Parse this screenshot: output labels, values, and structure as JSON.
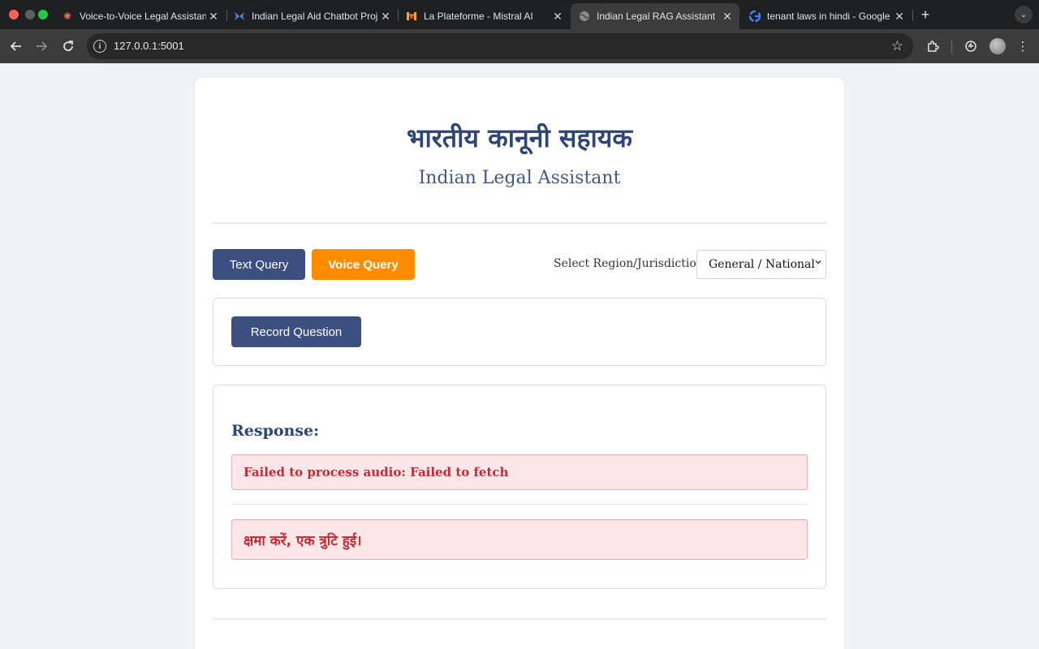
{
  "browser": {
    "tabs": [
      {
        "title": "Voice-to-Voice Legal Assistant",
        "icon": "asterisk-orange-icon"
      },
      {
        "title": "Indian Legal Aid Chatbot Project",
        "icon": "butterfly-blue-icon"
      },
      {
        "title": "La Plateforme - Mistral AI",
        "icon": "mistral-m-icon"
      },
      {
        "title": "Indian Legal RAG Assistant",
        "icon": "globe-icon",
        "active": true
      },
      {
        "title": "tenant laws in hindi - Google",
        "icon": "google-g-icon"
      }
    ],
    "url": "127.0.0.1:5001"
  },
  "header": {
    "title_hi": "भारतीय कानूनी सहायक",
    "title_en": "Indian Legal Assistant"
  },
  "mode": {
    "text_query": "Text Query",
    "voice_query": "Voice Query",
    "active": "voice_query"
  },
  "region": {
    "label": "Select Region/Jurisdiction:",
    "selected": "General / National"
  },
  "recorder": {
    "button": "Record Question"
  },
  "response": {
    "title": "Response:",
    "error": "Failed to process audio: Failed to fetch",
    "error_hi": "क्षमा करें, एक त्रुटि हुई।"
  },
  "colors": {
    "primary": "#3b5080",
    "accent": "#ff8c00",
    "error_bg": "#fde6e8",
    "error_text": "#c62834"
  }
}
